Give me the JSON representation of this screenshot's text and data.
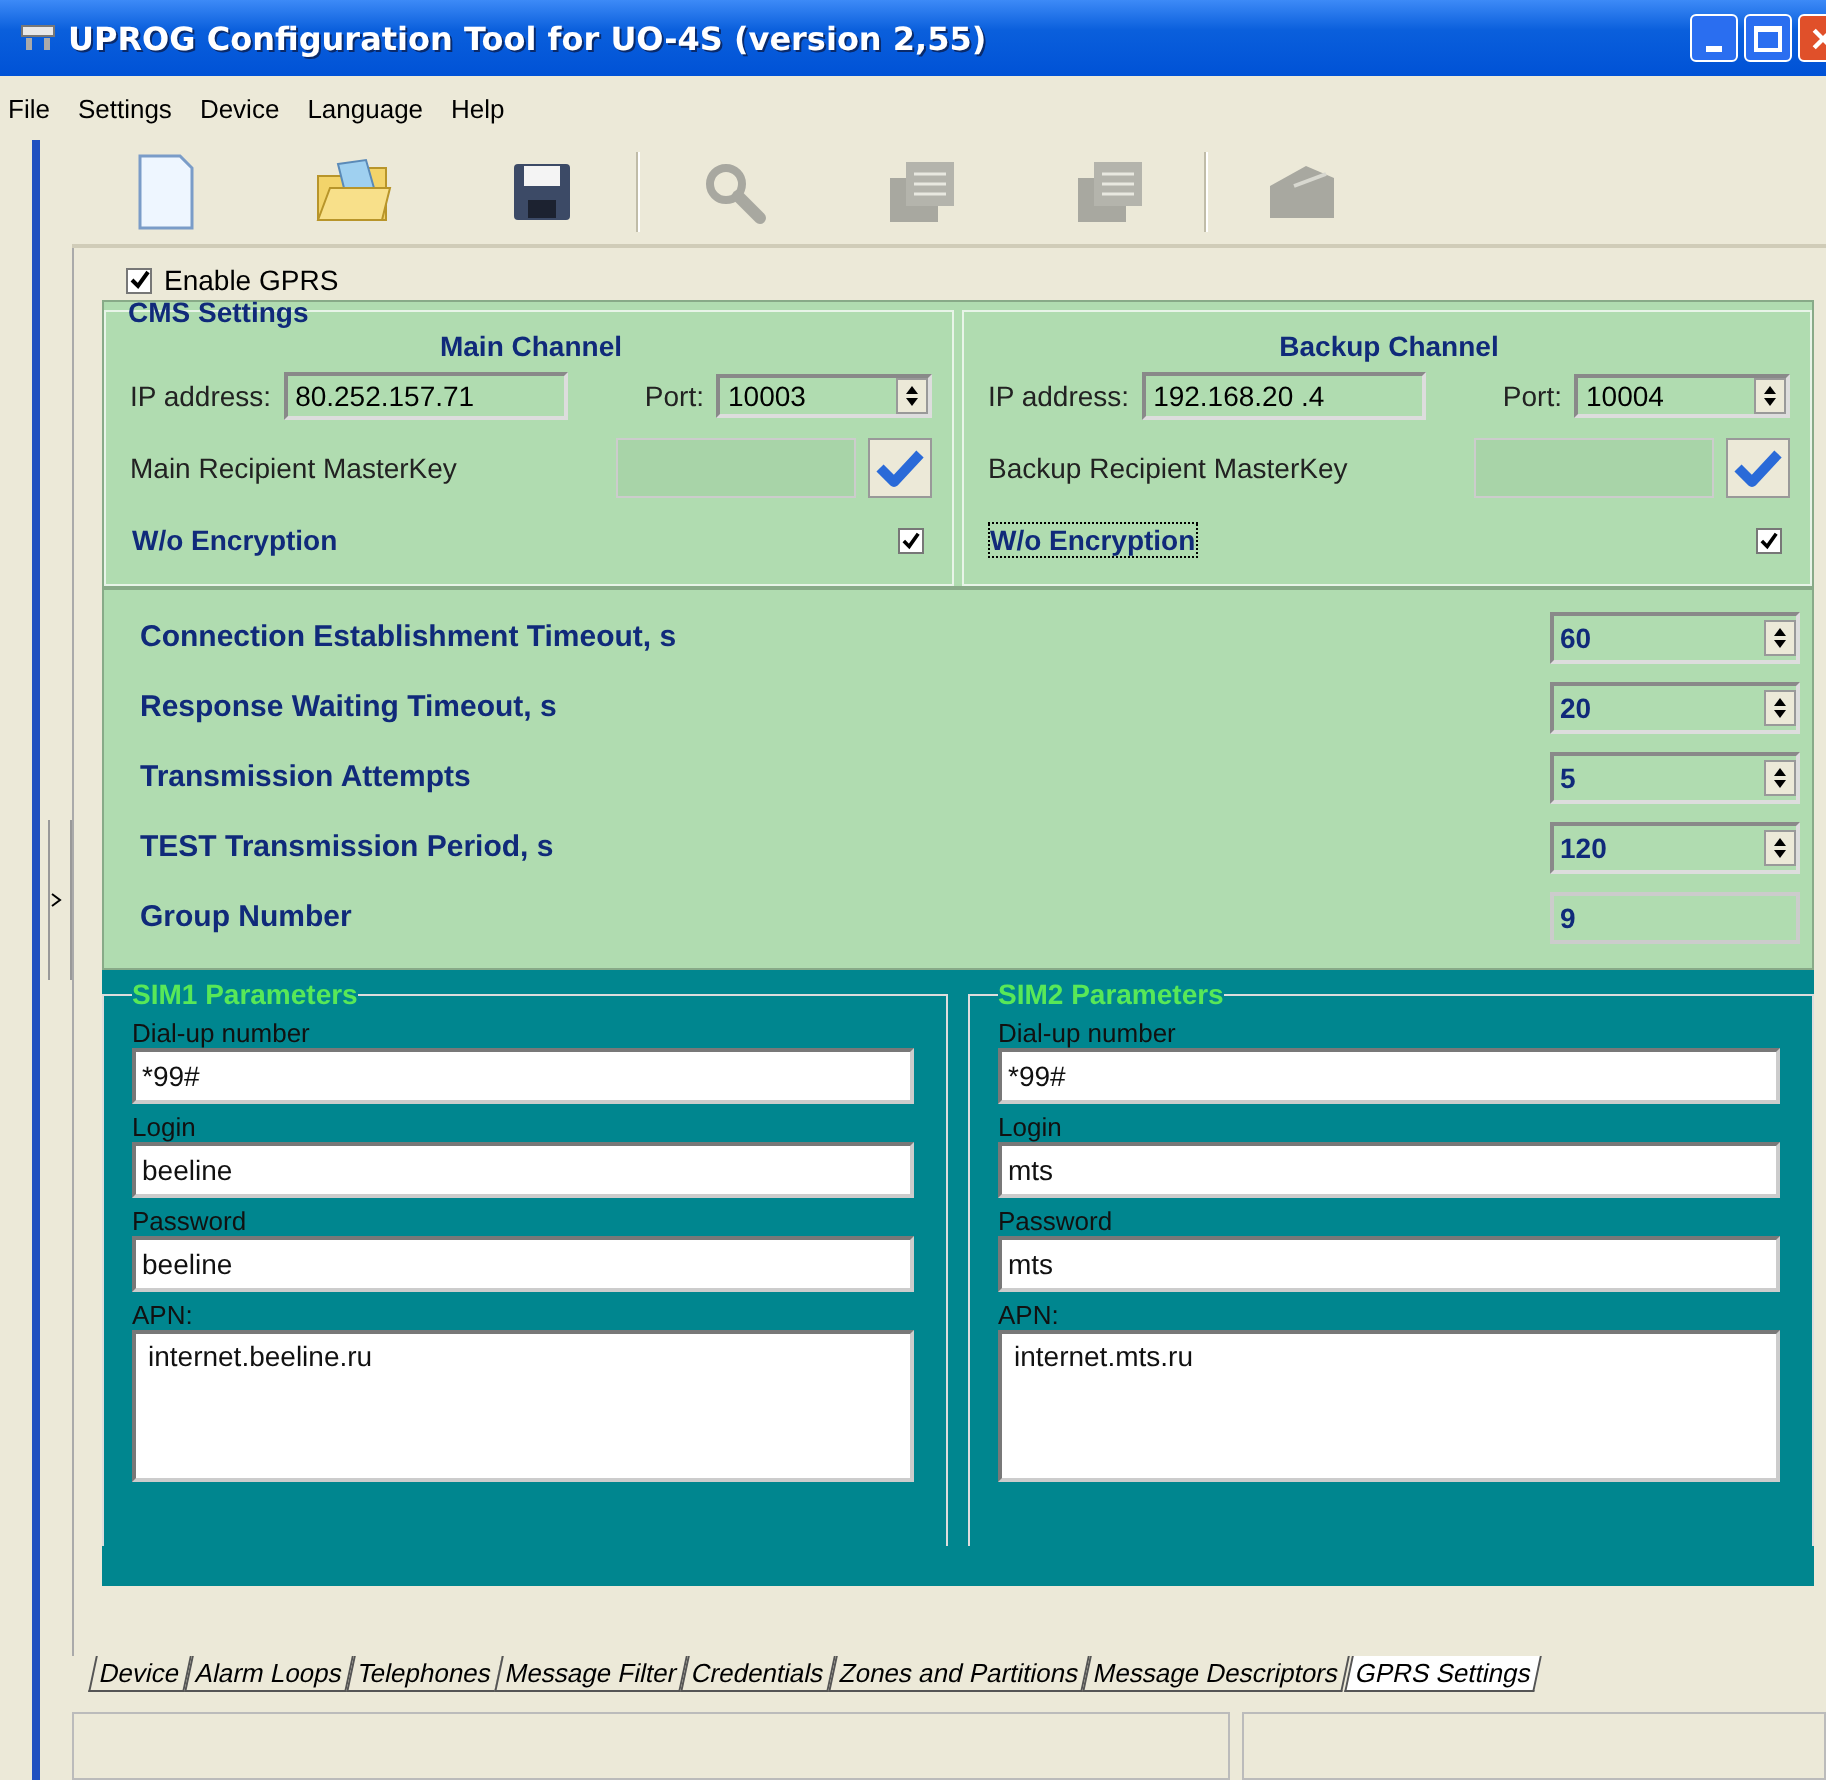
{
  "window": {
    "title": "UPROG Configuration Tool for UO-4S (version 2,55)"
  },
  "menu": [
    "File",
    "Settings",
    "Device",
    "Language",
    "Help"
  ],
  "toolbar": [
    {
      "kind": "new",
      "disabled": false
    },
    {
      "kind": "open",
      "disabled": false
    },
    {
      "kind": "save",
      "disabled": false
    },
    {
      "kind": "search",
      "disabled": true
    },
    {
      "kind": "read",
      "disabled": true
    },
    {
      "kind": "write",
      "disabled": true
    },
    {
      "kind": "device",
      "disabled": true
    }
  ],
  "enable_gprs": {
    "label": "Enable GPRS",
    "checked": true
  },
  "cms": {
    "title": "CMS Settings",
    "channels": [
      {
        "heading": "Main Channel",
        "ip_label": "IP address:",
        "ip": "80.252.157.71",
        "port_label": "Port:",
        "port": "10003",
        "key_label": "Main Recipient MasterKey",
        "encryption_label": "W/o Encryption",
        "encryption_checked": true,
        "focused": false
      },
      {
        "heading": "Backup Channel",
        "ip_label": "IP address:",
        "ip": "192.168.20 .4",
        "port_label": "Port:",
        "port": "10004",
        "key_label": "Backup Recipient MasterKey",
        "encryption_label": "W/o Encryption",
        "encryption_checked": true,
        "focused": true
      }
    ]
  },
  "timeouts": [
    {
      "label": "Connection Establishment Timeout, s",
      "value": "60",
      "kind": "spin"
    },
    {
      "label": "Response Waiting Timeout, s",
      "value": "20",
      "kind": "spin"
    },
    {
      "label": "Transmission Attempts",
      "value": "5",
      "kind": "spin"
    },
    {
      "label": "TEST Transmission Period, s",
      "value": "120",
      "kind": "spin"
    },
    {
      "label": "Group Number",
      "value": "9",
      "kind": "readonly"
    }
  ],
  "sims": [
    {
      "title": "SIM1 Parameters",
      "fields": [
        {
          "label": "Dial-up number",
          "value": "*99#",
          "kind": "line"
        },
        {
          "label": "Login",
          "value": "beeline",
          "kind": "line"
        },
        {
          "label": "Password",
          "value": "beeline",
          "kind": "line"
        },
        {
          "label": "APN:",
          "value": "internet.beeline.ru",
          "kind": "area"
        }
      ]
    },
    {
      "title": "SIM2 Parameters",
      "fields": [
        {
          "label": "Dial-up number",
          "value": "*99#",
          "kind": "line"
        },
        {
          "label": "Login",
          "value": "mts",
          "kind": "line"
        },
        {
          "label": "Password",
          "value": "mts",
          "kind": "line"
        },
        {
          "label": "APN:",
          "value": "internet.mts.ru",
          "kind": "area"
        }
      ]
    }
  ],
  "tabs": [
    {
      "label": "Device",
      "selected": false
    },
    {
      "label": "Alarm Loops",
      "selected": false
    },
    {
      "label": "Telephones",
      "selected": false
    },
    {
      "label": "Message Filter",
      "selected": false
    },
    {
      "label": "Credentials",
      "selected": false
    },
    {
      "label": "Zones and Partitions",
      "selected": false
    },
    {
      "label": "Message Descriptors",
      "selected": false
    },
    {
      "label": "GPRS Settings",
      "selected": true
    }
  ]
}
